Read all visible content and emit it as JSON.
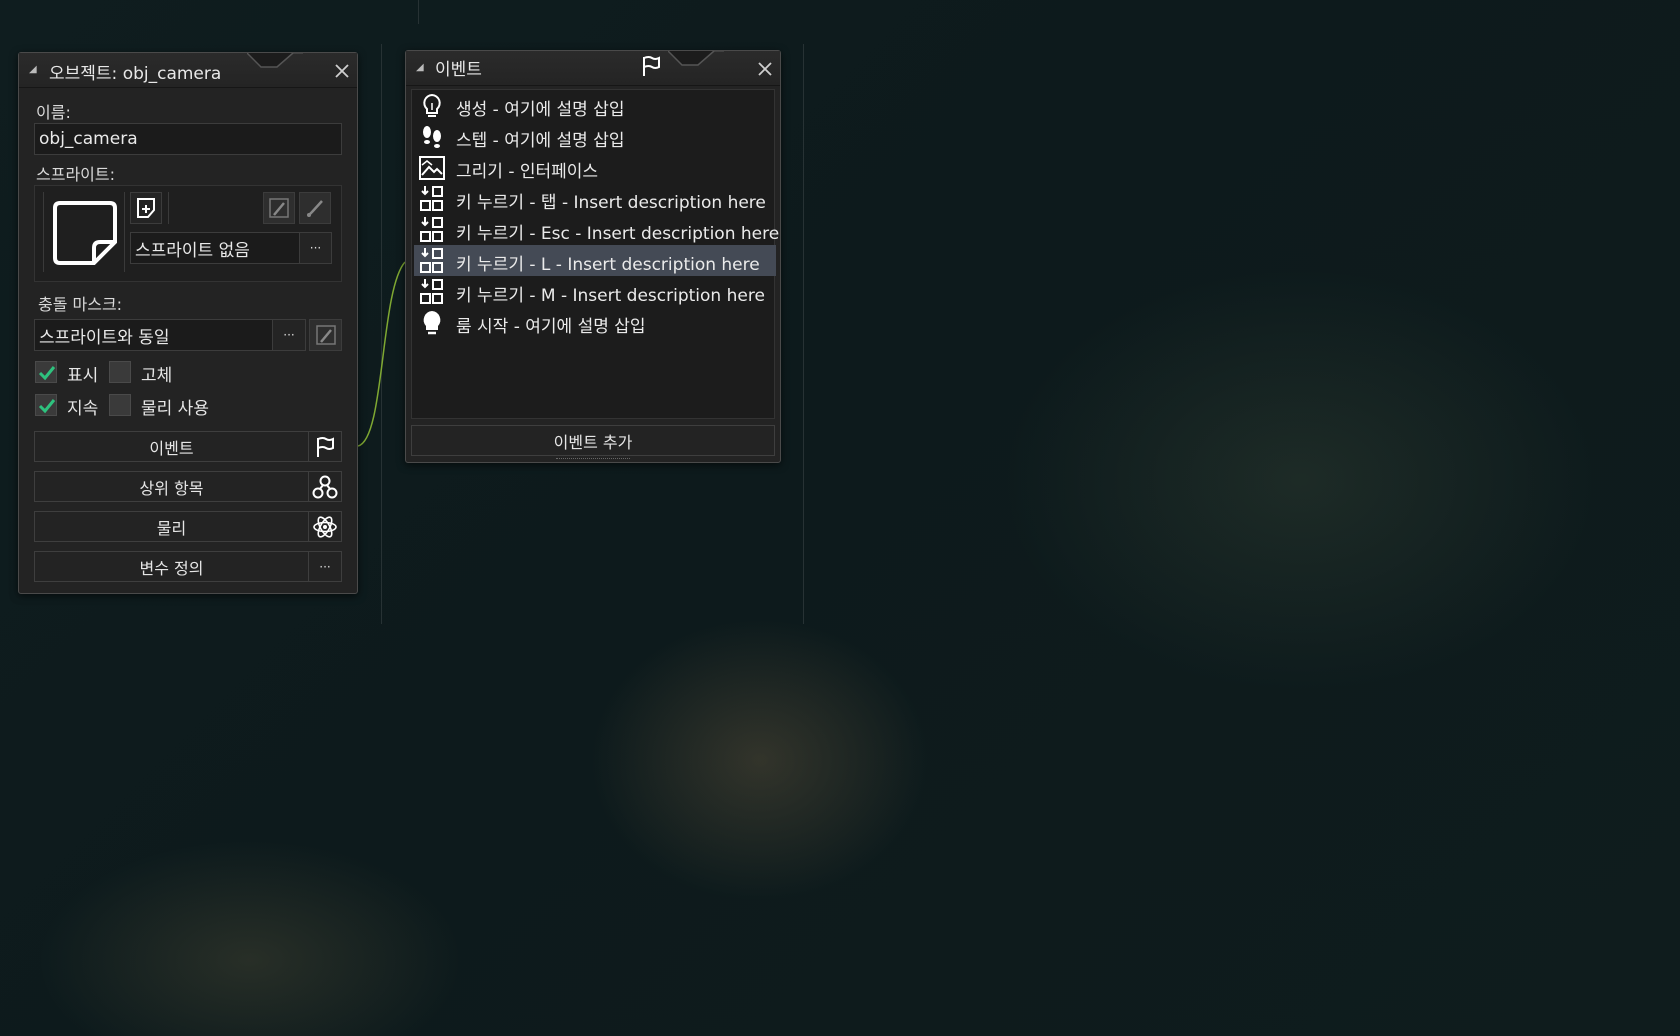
{
  "object_panel": {
    "title": "오브젝트: obj_camera",
    "name_label": "이름:",
    "name_value": "obj_camera",
    "sprite_label": "스프라이트:",
    "sprite_value": "스프라이트 없음",
    "sprite_more": "···",
    "collision_label": "충돌 마스크:",
    "collision_value": "스프라이트와 동일",
    "collision_more": "···",
    "checkboxes": [
      {
        "label": "표시",
        "checked": true
      },
      {
        "label": "고체",
        "checked": false
      },
      {
        "label": "지속",
        "checked": true
      },
      {
        "label": "물리 사용",
        "checked": false
      }
    ],
    "buttons": {
      "events": "이벤트",
      "parent": "상위 항목",
      "physics": "물리",
      "variables": "변수 정의",
      "variables_more": "···"
    }
  },
  "events_panel": {
    "title": "이벤트",
    "add_button": "이벤트 추가",
    "events": [
      {
        "icon": "lightbulb-outline-icon",
        "label": "생성 - 여기에 설명 삽입",
        "selected": false
      },
      {
        "icon": "footsteps-icon",
        "label": "스텝 - 여기에 설명 삽입",
        "selected": false
      },
      {
        "icon": "picture-icon",
        "label": "그리기 - 인터페이스",
        "selected": false
      },
      {
        "icon": "key-press-icon",
        "label": "키 누르기 - 탭 - Insert description here",
        "selected": false
      },
      {
        "icon": "key-press-icon",
        "label": "키 누르기 - Esc - Insert description here",
        "selected": false
      },
      {
        "icon": "key-press-icon",
        "label": "키 누르기 - L - Insert description here",
        "selected": true
      },
      {
        "icon": "key-press-icon",
        "label": "키 누르기 - M - Insert description here",
        "selected": false
      },
      {
        "icon": "lightbulb-filled-icon",
        "label": "룸 시작 - 여기에 설명 삽입",
        "selected": false
      }
    ]
  },
  "colors": {
    "panel_bg": "#232323",
    "selected_row": "#444a55",
    "check_green": "#2ec27e",
    "connector": "#7fa832"
  }
}
